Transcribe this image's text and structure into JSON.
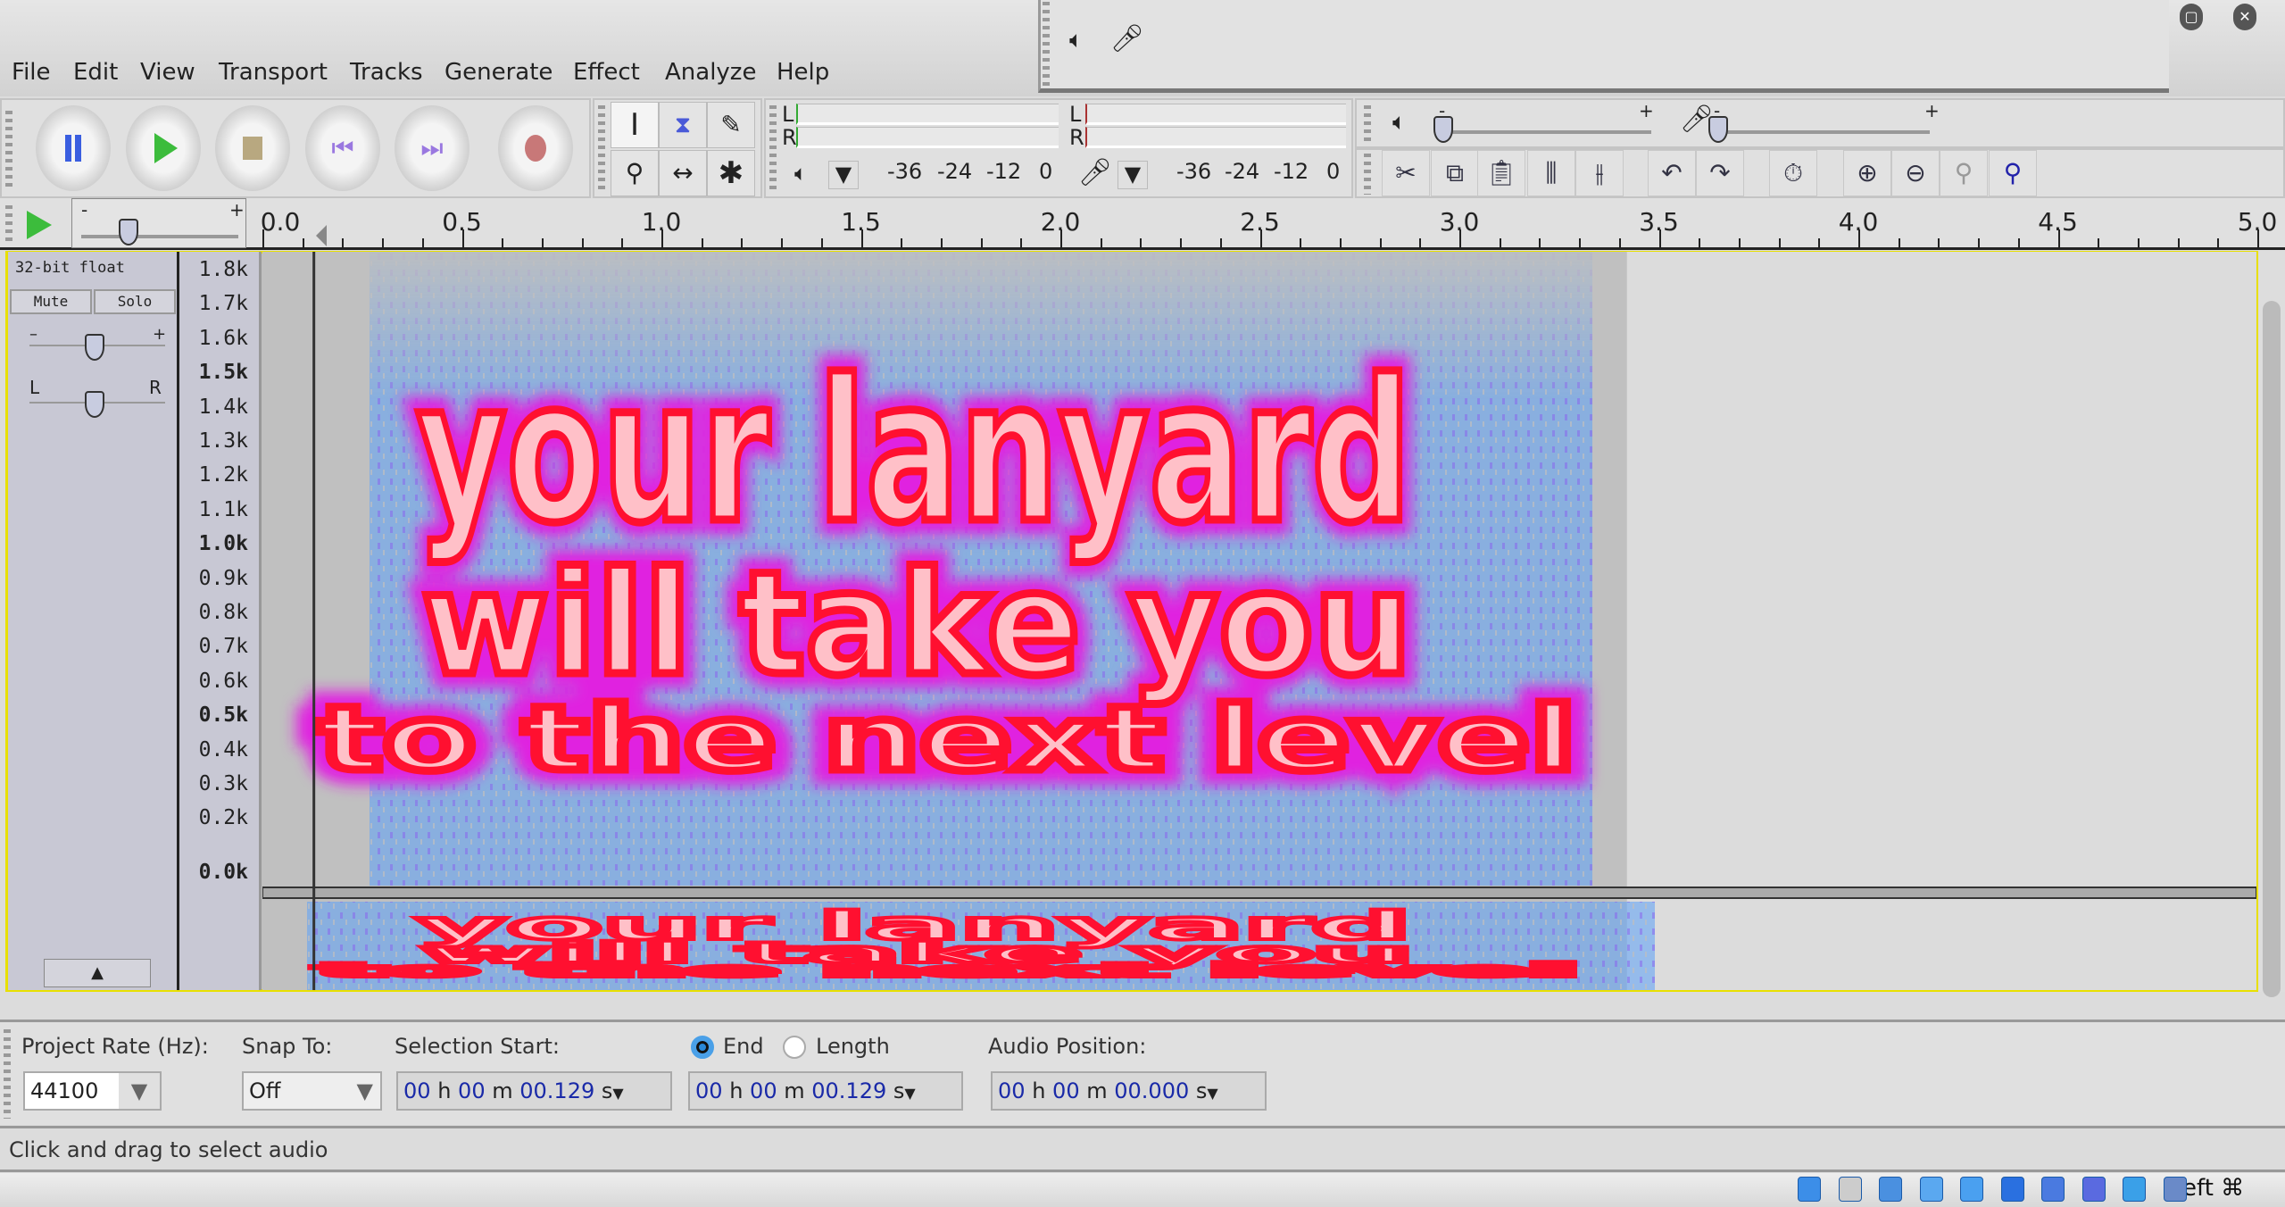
{
  "menu": [
    "File",
    "Edit",
    "View",
    "Transport",
    "Tracks",
    "Generate",
    "Effect",
    "Analyze",
    "Help"
  ],
  "window_buttons": [
    "restore-icon",
    "close-icon"
  ],
  "transport": {
    "buttons": [
      "pause",
      "play",
      "stop",
      "skip-to-start",
      "skip-to-end",
      "record"
    ],
    "colors": {
      "pause": "#3a5ee0",
      "play": "#3cbc3c",
      "stop": "#b8a880",
      "skip": "#9a78e0",
      "record": "#c87878"
    }
  },
  "tools": [
    "selection-tool",
    "envelope-tool",
    "draw-tool",
    "zoom-tool",
    "time-shift-tool",
    "multi-tool"
  ],
  "meters": {
    "play_l": "L",
    "play_r": "R",
    "rec_l": "L",
    "rec_r": "R",
    "play_scale": [
      "-36",
      "-24",
      "-12",
      "0"
    ],
    "rec_scale": [
      "-36",
      "-24",
      "-12",
      "0"
    ]
  },
  "mixer": {
    "minus": "-",
    "plus": "+"
  },
  "edit_toolbar": [
    "trim-audio",
    "silence-audio",
    "paste",
    "trim",
    "silence",
    "undo",
    "redo",
    "sync-lock",
    "zoom-in",
    "zoom-out",
    "fit-selection",
    "fit-project"
  ],
  "ruler": {
    "labels": [
      "0.0",
      "0.5",
      "1.0",
      "1.5",
      "2.0",
      "2.5",
      "3.0",
      "3.5",
      "4.0",
      "4.5",
      "5.0"
    ]
  },
  "track": {
    "format": "32-bit float",
    "mute": "Mute",
    "solo": "Solo",
    "gain_minus": "–",
    "gain_plus": "+",
    "pan_left": "L",
    "pan_right": "R",
    "gain": 0.5,
    "pan": 0.5
  },
  "freq_axis": [
    {
      "t": "1.8k",
      "b": false
    },
    {
      "t": "1.7k",
      "b": false
    },
    {
      "t": "1.6k",
      "b": false
    },
    {
      "t": "1.5k",
      "b": true
    },
    {
      "t": "1.4k",
      "b": false
    },
    {
      "t": "1.3k",
      "b": false
    },
    {
      "t": "1.2k",
      "b": false
    },
    {
      "t": "1.1k",
      "b": false
    },
    {
      "t": "1.0k",
      "b": true
    },
    {
      "t": "0.9k",
      "b": false
    },
    {
      "t": "0.8k",
      "b": false
    },
    {
      "t": "0.7k",
      "b": false
    },
    {
      "t": "0.6k",
      "b": false
    },
    {
      "t": "0.5k",
      "b": true
    },
    {
      "t": "0.4k",
      "b": false
    },
    {
      "t": "0.3k",
      "b": false
    },
    {
      "t": "0.2k",
      "b": false
    },
    {
      "t": "",
      "b": false
    },
    {
      "t": "0.0k",
      "b": true
    }
  ],
  "spectrogram": {
    "lines": [
      "your lanyard",
      "will take you",
      "to the next level"
    ],
    "clip_end_seconds": 3.42,
    "cursor_seconds": 0.129,
    "colors": {
      "glyph": "#ff1030",
      "halo": "#e020e0",
      "noise": "#5aa0f8",
      "background": "#c0c0c0"
    }
  },
  "selection": {
    "project_rate_label": "Project Rate (Hz):",
    "project_rate": "44100",
    "snap_label": "Snap To:",
    "snap": "Off",
    "start_label": "Selection Start:",
    "end_label": "End",
    "length_label": "Length",
    "end_selected": true,
    "audio_pos_label": "Audio Position:",
    "start": {
      "h": "00",
      "m": "00",
      "s": "00.129"
    },
    "end": {
      "h": "00",
      "m": "00",
      "s": "00.129"
    },
    "pos": {
      "h": "00",
      "m": "00",
      "s": "00.000"
    },
    "h": "h",
    "mu": "m",
    "su": "s"
  },
  "status": "Click and drag to select audio",
  "taskbar": {
    "icons": [
      "hard-disk-icon",
      "optical-disk-icon",
      "network-icon",
      "usb-icon",
      "shared-folder-icon",
      "display-icon",
      "video-capture-icon",
      "cpu-icon",
      "mouse-integration-icon",
      "arrow-down-icon"
    ],
    "host_key": "Left ⌘"
  }
}
